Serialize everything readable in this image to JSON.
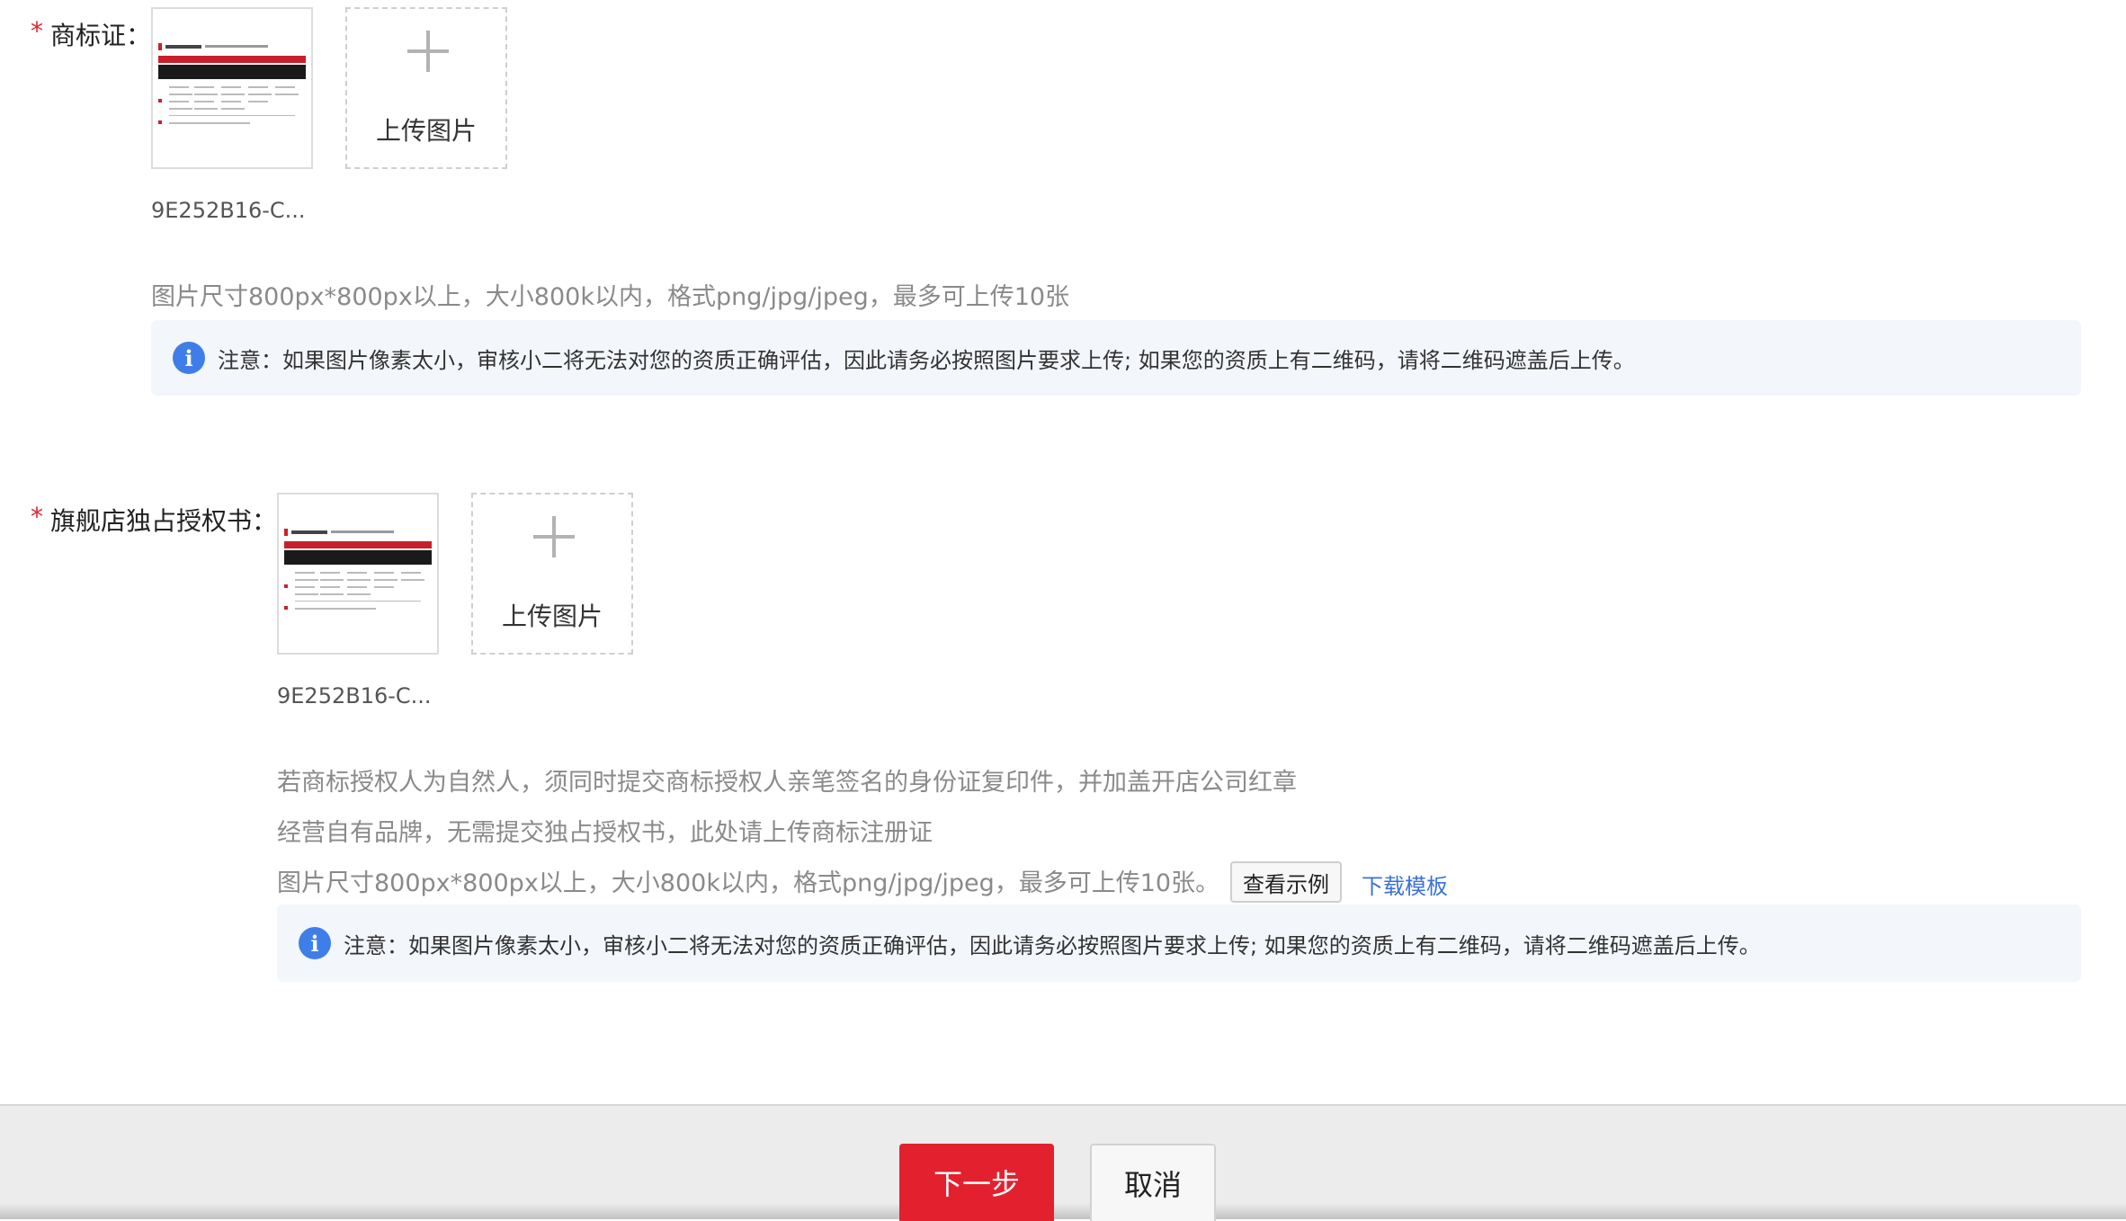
{
  "trademark": {
    "required_mark": "*",
    "label": "商标证：",
    "filename": "9E252B16-C...",
    "upload_label": "上传图片",
    "hint": "图片尺寸800px*800px以上，大小800k以内，格式png/jpg/jpeg，最多可上传10张",
    "notice": "注意：如果图片像素太小，审核小二将无法对您的资质正确评估，因此请务必按照图片要求上传; 如果您的资质上有二维码，请将二维码遮盖后上传。"
  },
  "authorization": {
    "required_mark": "*",
    "label": "旗舰店独占授权书：",
    "filename": "9E252B16-C...",
    "upload_label": "上传图片",
    "hint_line1": "若商标授权人为自然人，须同时提交商标授权人亲笔签名的身份证复印件，并加盖开店公司红章",
    "hint_line2": "经营自有品牌，无需提交独占授权书，此处请上传商标注册证",
    "hint_line3": "图片尺寸800px*800px以上，大小800k以内，格式png/jpg/jpeg，最多可上传10张。",
    "example_button": "查看示例",
    "download_link": "下载模板",
    "notice": "注意：如果图片像素太小，审核小二将无法对您的资质正确评估，因此请务必按照图片要求上传; 如果您的资质上有二维码，请将二维码遮盖后上传。"
  },
  "footer": {
    "next_label": "下一步",
    "cancel_label": "取消"
  },
  "colors": {
    "required": "#e02433",
    "primary_button": "#e3212e",
    "link": "#3a72d6",
    "info_icon": "#3f7ee8",
    "notice_bg": "#f3f6fb"
  },
  "icons": {
    "info": "i",
    "upload": "plus-icon"
  }
}
